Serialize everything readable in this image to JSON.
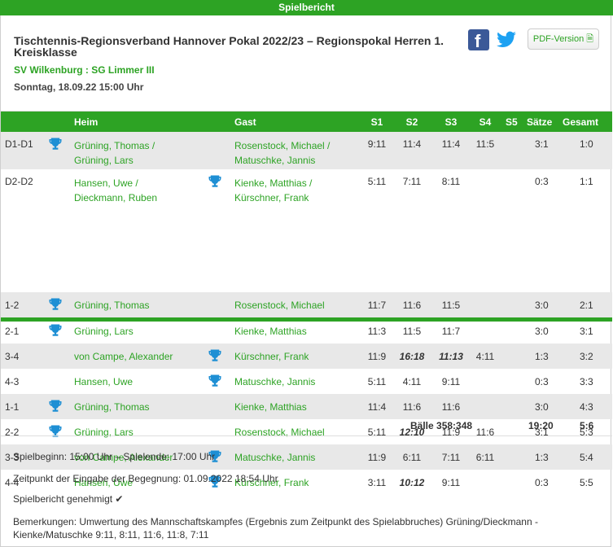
{
  "topbar": {
    "label": "Spielbericht"
  },
  "header": {
    "title": "Tischtennis-Regionsverband Hannover Pokal 2022/23 – Regionspokal Herren 1. Kreisklasse",
    "teams": "SV Wilkenburg : SG Limmer III",
    "date": "Sonntag, 18.09.22 15:00 Uhr",
    "pdf_label": "PDF-Version"
  },
  "table": {
    "columns": [
      "Heim",
      "Gast",
      "S1",
      "S2",
      "S3",
      "S4",
      "S5",
      "Sätze",
      "Gesamt"
    ],
    "rows": [
      {
        "pos": "D1-D1",
        "home": "Grüning, Thomas /",
        "home2": "Grüning, Lars",
        "guest": "Rosenstock, Michael /",
        "guest2": "Matuschke, Jannis",
        "s1": "9:11",
        "s2": "11:4",
        "s3": "11:4",
        "s4": "11:5",
        "s5": "",
        "saetze": "3:1",
        "gesamt": "1:0",
        "winner": "home"
      },
      {
        "pos": "D2-D2",
        "home": "Hansen, Uwe /",
        "home2": "Dieckmann, Ruben",
        "guest": "Kienke, Matthias /",
        "guest2": "Kürschner, Frank",
        "s1": "5:11",
        "s2": "7:11",
        "s3": "8:11",
        "s4": "",
        "s5": "",
        "saetze": "0:3",
        "gesamt": "1:1",
        "winner": "guest"
      },
      {
        "pos": "1-2",
        "home": "Grüning, Thomas",
        "guest": "Rosenstock, Michael",
        "s1": "11:7",
        "s2": "11:6",
        "s3": "11:5",
        "s4": "",
        "s5": "",
        "saetze": "3:0",
        "gesamt": "2:1",
        "winner": "home"
      },
      {
        "pos": "2-1",
        "home": "Grüning, Lars",
        "guest": "Kienke, Matthias",
        "s1": "11:3",
        "s2": "11:5",
        "s3": "11:7",
        "s4": "",
        "s5": "",
        "saetze": "3:0",
        "gesamt": "3:1",
        "winner": "home"
      },
      {
        "pos": "3-4",
        "home": "von Campe, Alexander",
        "guest": "Kürschner, Frank",
        "s1": "11:9",
        "s2": "16:18",
        "s3": "11:13",
        "s4": "4:11",
        "s5": "",
        "saetze": "1:3",
        "gesamt": "3:2",
        "winner": "guest"
      },
      {
        "pos": "4-3",
        "home": "Hansen, Uwe",
        "guest": "Matuschke, Jannis",
        "s1": "5:11",
        "s2": "4:11",
        "s3": "9:11",
        "s4": "",
        "s5": "",
        "saetze": "0:3",
        "gesamt": "3:3",
        "winner": "guest"
      },
      {
        "pos": "1-1",
        "home": "Grüning, Thomas",
        "guest": "Kienke, Matthias",
        "s1": "11:4",
        "s2": "11:6",
        "s3": "11:6",
        "s4": "",
        "s5": "",
        "saetze": "3:0",
        "gesamt": "4:3",
        "winner": "home"
      },
      {
        "pos": "2-2",
        "home": "Grüning, Lars",
        "guest": "Rosenstock, Michael",
        "s1": "5:11",
        "s2": "12:10",
        "s3": "11:9",
        "s4": "11:6",
        "s5": "",
        "saetze": "3:1",
        "gesamt": "5:3",
        "winner": "home"
      },
      {
        "pos": "3-3",
        "home": "von Campe, Alexander",
        "guest": "Matuschke, Jannis",
        "s1": "11:9",
        "s2": "6:11",
        "s3": "7:11",
        "s4": "6:11",
        "s5": "",
        "saetze": "1:3",
        "gesamt": "5:4",
        "winner": "guest"
      },
      {
        "pos": "4-4",
        "home": "Hansen, Uwe",
        "guest": "Kürschner, Frank",
        "s1": "3:11",
        "s2": "10:12",
        "s3": "9:11",
        "s4": "",
        "s5": "",
        "saetze": "0:3",
        "gesamt": "5:5",
        "winner": "guest"
      }
    ],
    "totals": {
      "baelle": "Bälle 358:348",
      "saetze": "19:20",
      "gesamt": "5:6"
    }
  },
  "footer": {
    "times": "Spielbeginn: 15:00 Uhr – Spielende: 17:00 Uhr",
    "entry": "Zeitpunkt der Eingabe der Begegnung: 01.09.2022 18:54 Uhr",
    "approved": "Spielbericht genehmigt",
    "remarks": "Bemerkungen: Umwertung des Mannschaftskampfes (Ergebnis zum Zeitpunkt des Spielabbruches) Grüning/Dieckmann - Kienke/Matuschke 9:11, 8:11, 11:6, 11:8, 7:11"
  }
}
